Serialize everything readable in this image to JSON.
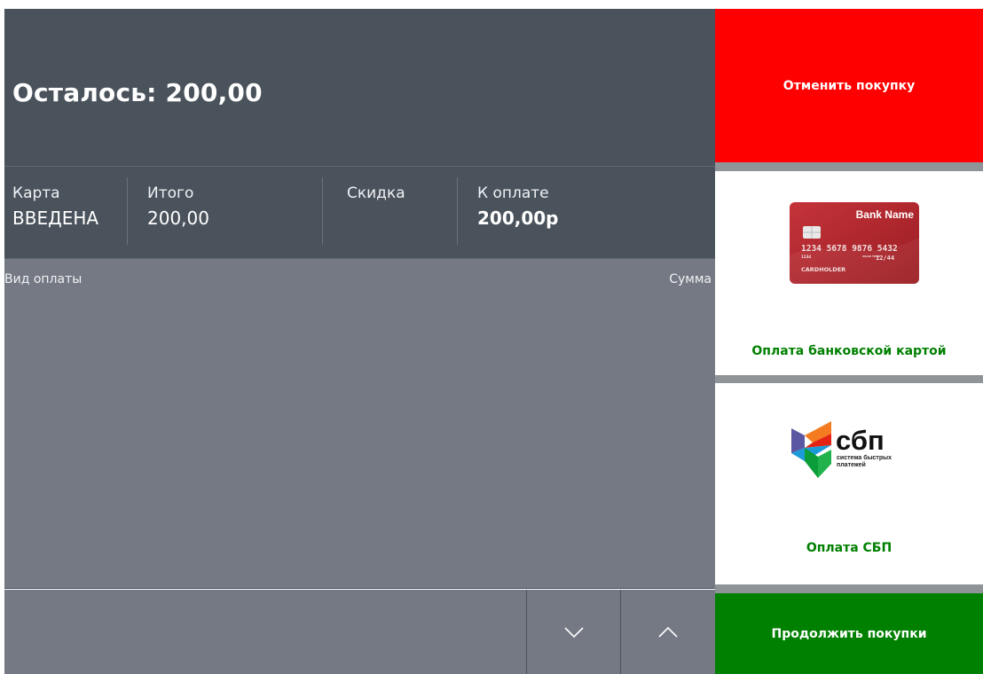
{
  "header": {
    "remaining_text": "Осталось: 200,00"
  },
  "totals": {
    "card_label": "Карта",
    "card_value": "ВВЕДЕНА",
    "total_label": "Итого",
    "total_value": "200,00",
    "discount_label": "Скидка",
    "discount_value": "",
    "topay_label": "К оплате",
    "topay_value": "200,00р"
  },
  "list": {
    "col_type": "Вид оплаты",
    "col_sum": "Сумма"
  },
  "nav": {
    "down_icon": "chevron-down-icon",
    "up_icon": "chevron-up-icon"
  },
  "actions": {
    "cancel_label": "Отменить покупку",
    "card_pay_label": "Оплата банковской картой",
    "sbp_pay_label": "Оплата СБП",
    "continue_label": "Продолжить покупки"
  },
  "bank_card": {
    "bank_name": "Bank Name",
    "number": "1234 5678 9876 5432",
    "small_number": "1234",
    "valid_label": "VALID THRU",
    "expiry": "12/44",
    "holder": "CARDHOLDER"
  },
  "sbp_logo": {
    "brand": "сбп",
    "tagline_1": "система быстрых",
    "tagline_2": "платежей"
  },
  "colors": {
    "header_bg": "#4a535c",
    "list_bg": "#747983",
    "cancel": "#ff0000",
    "continue": "#008000",
    "pay_label": "#008000",
    "card_red": "#b5262a"
  }
}
